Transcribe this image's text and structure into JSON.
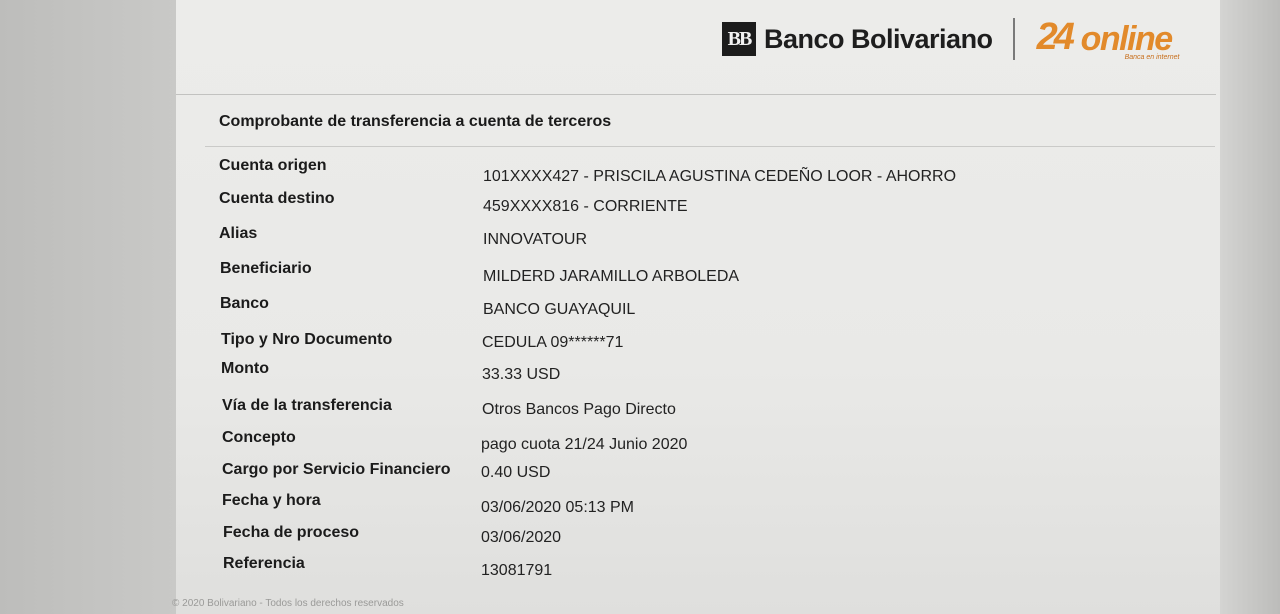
{
  "brand": {
    "bank_name": "Banco Bolivariano",
    "logo_letters": "BB",
    "online_number": "24",
    "online_word": "online",
    "online_tagline": "Banca en internet"
  },
  "document": {
    "title": "Comprobante de transferencia a cuenta de terceros",
    "rows": [
      {
        "label": "Cuenta origen",
        "value": "101XXXX427 - PRISCILA AGUSTINA CEDEÑO LOOR - AHORRO"
      },
      {
        "label": "Cuenta destino",
        "value": "459XXXX816 - CORRIENTE"
      },
      {
        "label": "Alias",
        "value": "INNOVATOUR"
      },
      {
        "label": "Beneficiario",
        "value": "MILDERD JARAMILLO ARBOLEDA"
      },
      {
        "label": "Banco",
        "value": "BANCO GUAYAQUIL"
      },
      {
        "label": "Tipo y Nro Documento",
        "value": "CEDULA 09******71"
      },
      {
        "label": "Monto",
        "value": "33.33 USD"
      },
      {
        "label": "Vía de la transferencia",
        "value": "Otros Bancos Pago Directo"
      },
      {
        "label": "Concepto",
        "value": "pago cuota 21/24 Junio 2020"
      },
      {
        "label": "Cargo por Servicio Financiero",
        "value": "0.40 USD"
      },
      {
        "label": "Fecha y hora",
        "value": "03/06/2020 05:13 PM"
      },
      {
        "label": "Fecha de proceso",
        "value": "03/06/2020"
      },
      {
        "label": "Referencia",
        "value": "13081791"
      }
    ]
  },
  "footer": {
    "text": "© 2020 Bolivariano - Todos los derechos reservados"
  },
  "colors": {
    "online_orange": "#e28a2b",
    "logo_dark": "#1c1c1c"
  }
}
